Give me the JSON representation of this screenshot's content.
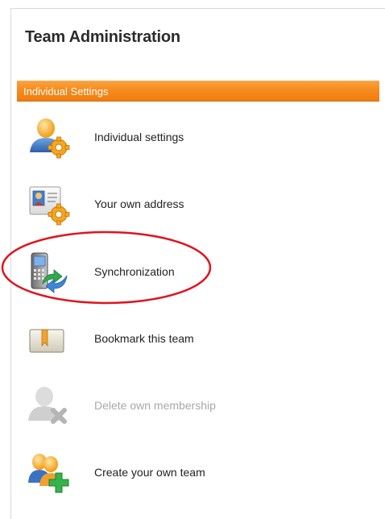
{
  "page": {
    "title": "Team Administration"
  },
  "section": {
    "label": "Individual Settings"
  },
  "items": [
    {
      "label": "Individual settings",
      "icon": "user-gear-icon",
      "enabled": true
    },
    {
      "label": "Your own address",
      "icon": "address-card-gear-icon",
      "enabled": true
    },
    {
      "label": "Synchronization",
      "icon": "mobile-sync-icon",
      "enabled": true
    },
    {
      "label": "Bookmark this team",
      "icon": "bookmark-icon",
      "enabled": true
    },
    {
      "label": "Delete own membership",
      "icon": "user-delete-icon",
      "enabled": false
    },
    {
      "label": "Create your own team",
      "icon": "team-add-icon",
      "enabled": true
    }
  ],
  "colors": {
    "section_bar": "#f68b1e",
    "highlight": "#e0141e",
    "disabled_text": "#a8a8a8"
  }
}
